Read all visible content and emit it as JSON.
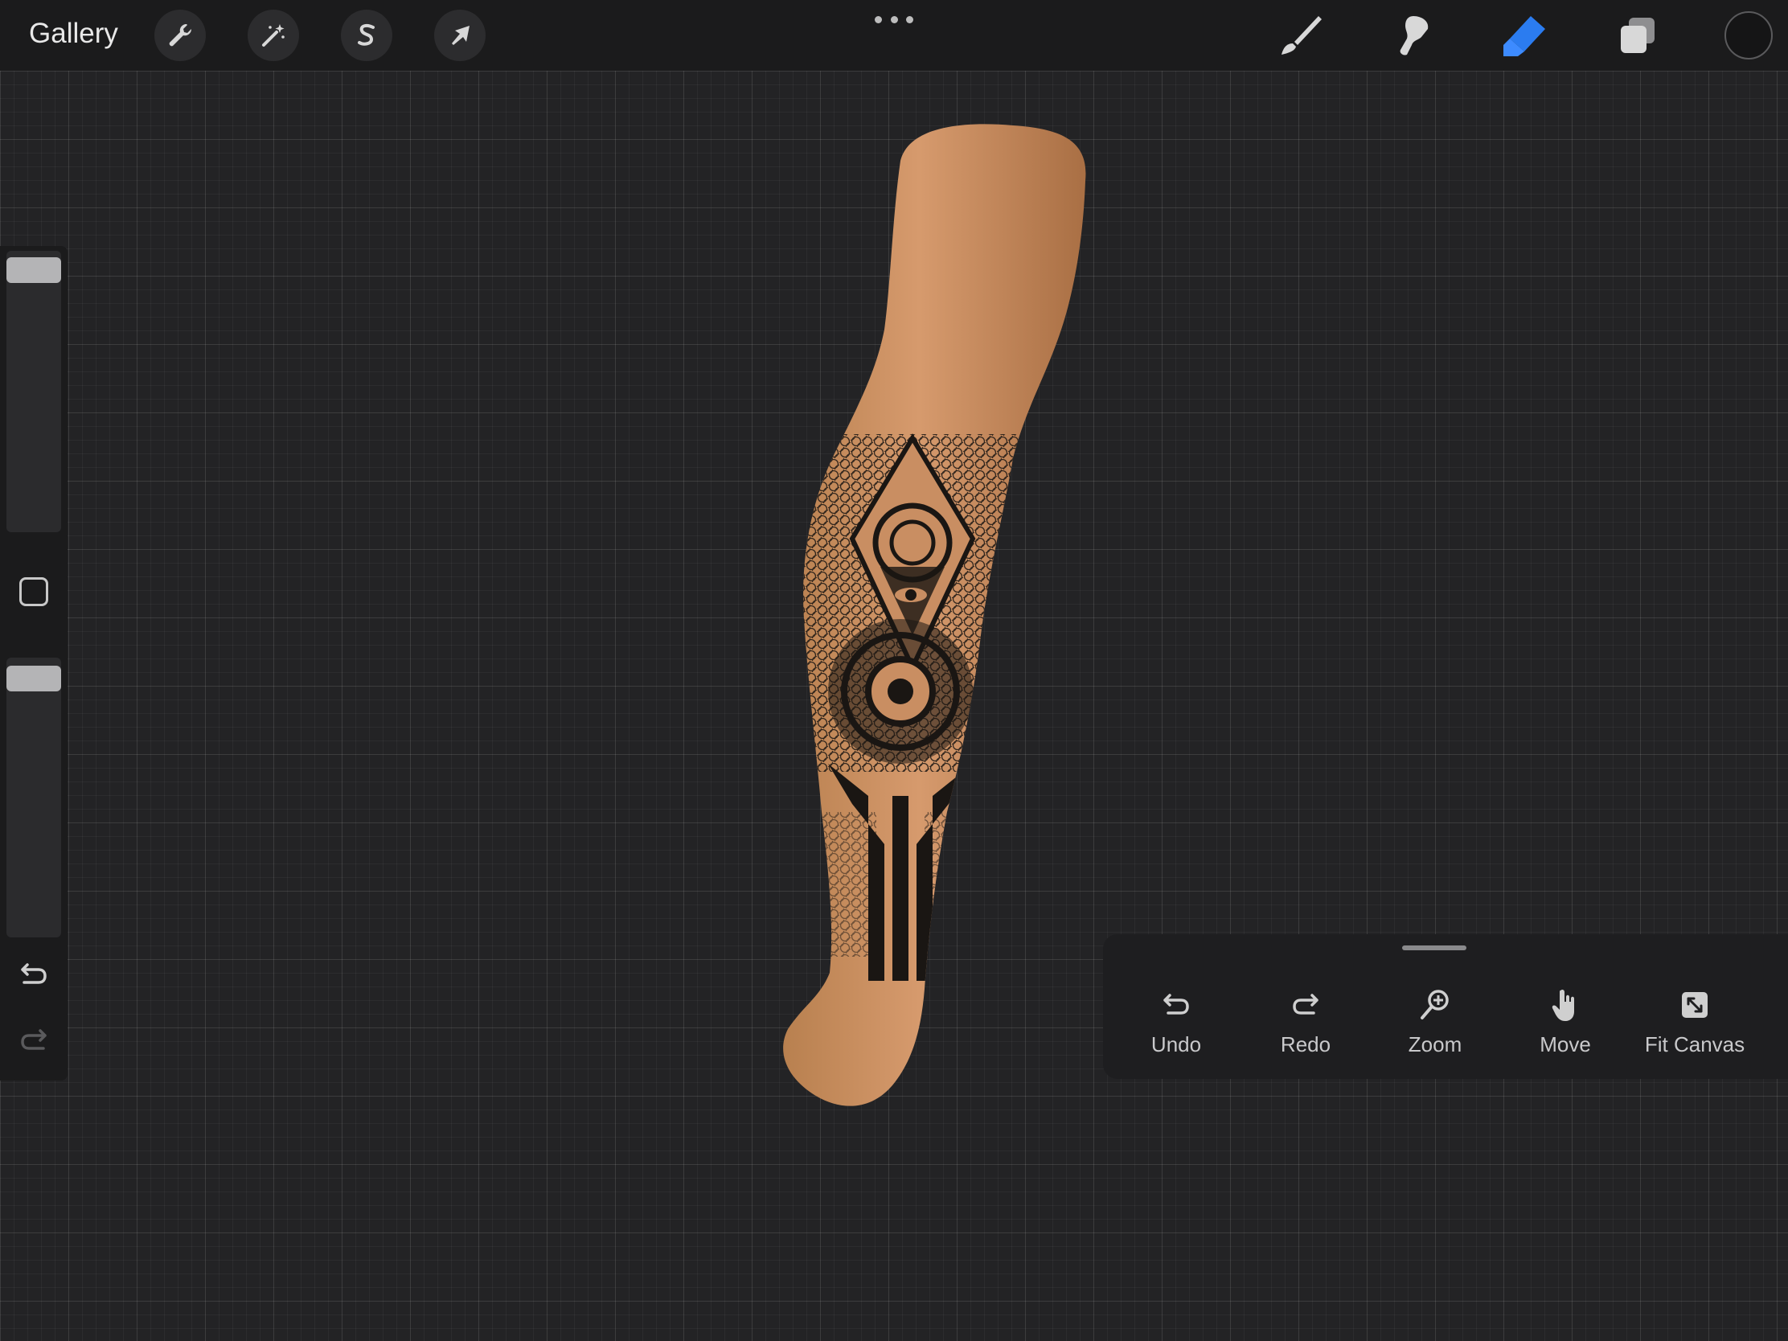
{
  "topbar": {
    "gallery_label": "Gallery",
    "left_tools": [
      {
        "name": "actions",
        "icon": "wrench-icon"
      },
      {
        "name": "adjustments",
        "icon": "magic-wand-icon"
      },
      {
        "name": "selection",
        "icon": "selection-s-icon"
      },
      {
        "name": "transform",
        "icon": "arrow-cursor-icon"
      }
    ],
    "more_icon": "more-dots-icon",
    "right_tools": [
      {
        "name": "brush",
        "icon": "brush-icon",
        "active": false
      },
      {
        "name": "smudge",
        "icon": "smudge-icon",
        "active": false
      },
      {
        "name": "eraser",
        "icon": "eraser-icon",
        "active": true
      },
      {
        "name": "layers",
        "icon": "layers-icon",
        "active": false
      }
    ],
    "active_color": "#151516",
    "accent_color": "#2b7cf0"
  },
  "sidebar": {
    "brush_size_level": 1.0,
    "opacity_level": 1.0,
    "modifier_icon": "square-modifier-icon",
    "undo_icon": "undo-icon",
    "redo_icon": "redo-icon"
  },
  "quick_menu": {
    "items": [
      {
        "label": "Undo",
        "icon": "undo-icon"
      },
      {
        "label": "Redo",
        "icon": "redo-icon"
      },
      {
        "label": "Zoom",
        "icon": "zoom-icon"
      },
      {
        "label": "Move",
        "icon": "hand-icon"
      },
      {
        "label": "Fit Canvas",
        "icon": "fit-canvas-icon"
      }
    ]
  },
  "artwork": {
    "subject": "leg-tattoo",
    "skin_color": "#c98e62",
    "ink_color": "#1a1613"
  }
}
